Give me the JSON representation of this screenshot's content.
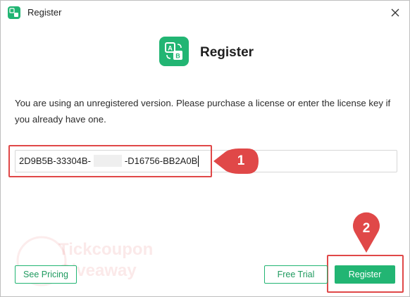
{
  "window": {
    "title": "Register"
  },
  "header": {
    "title": "Register"
  },
  "message": "You are using an unregistered version. Please purchase a license or enter the license key if you already have one.",
  "license_key": {
    "part1": "2D9B5B-33304B-",
    "part2": "-D16756-BB2A0B"
  },
  "annotations": {
    "step1": "1",
    "step2": "2"
  },
  "buttons": {
    "see_pricing": "See Pricing",
    "free_trial": "Free Trial",
    "register": "Register"
  },
  "watermark": {
    "line1": "Tickcoupon",
    "line2": "Giveaway"
  },
  "colors": {
    "accent": "#22b573",
    "annotation": "#e04848"
  },
  "icons": {
    "app": "app-ab-icon",
    "close": "close-icon"
  }
}
